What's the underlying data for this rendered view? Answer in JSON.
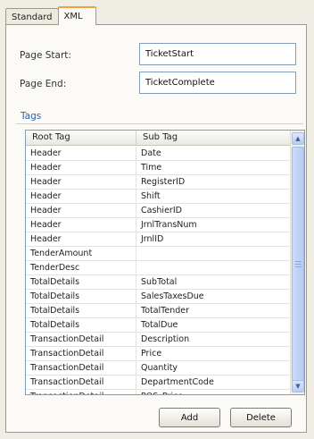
{
  "tabs": [
    {
      "label": "Standard"
    },
    {
      "label": "XML"
    }
  ],
  "fields": {
    "page_start": {
      "label": "Page Start:",
      "value": "TicketStart"
    },
    "page_end": {
      "label": "Page End:",
      "value": "TicketComplete"
    }
  },
  "tags": {
    "title": "Tags",
    "columns": [
      "Root Tag",
      "Sub Tag"
    ],
    "rows": [
      [
        "Header",
        "Date"
      ],
      [
        "Header",
        "Time"
      ],
      [
        "Header",
        "RegisterID"
      ],
      [
        "Header",
        "Shift"
      ],
      [
        "Header",
        "CashierID"
      ],
      [
        "Header",
        "JrnlTransNum"
      ],
      [
        "Header",
        "JrnlID"
      ],
      [
        "TenderAmount",
        ""
      ],
      [
        "TenderDesc",
        ""
      ],
      [
        "TotalDetails",
        "SubTotal"
      ],
      [
        "TotalDetails",
        "SalesTaxesDue"
      ],
      [
        "TotalDetails",
        "TotalTender"
      ],
      [
        "TotalDetails",
        "TotalDue"
      ],
      [
        "TransactionDetail",
        "Description"
      ],
      [
        "TransactionDetail",
        "Price"
      ],
      [
        "TransactionDetail",
        "Quantity"
      ],
      [
        "TransactionDetail",
        "DepartmentCode"
      ],
      [
        "TransactionDetail",
        "POS_Price"
      ]
    ]
  },
  "buttons": {
    "add": "Add",
    "delete": "Delete"
  },
  "icons": {
    "scroll_up": "chevron-up-icon",
    "scroll_down": "chevron-down-icon"
  },
  "colors": {
    "active_tab_accent": "#f2a13a",
    "group_title": "#2a5fb3"
  }
}
